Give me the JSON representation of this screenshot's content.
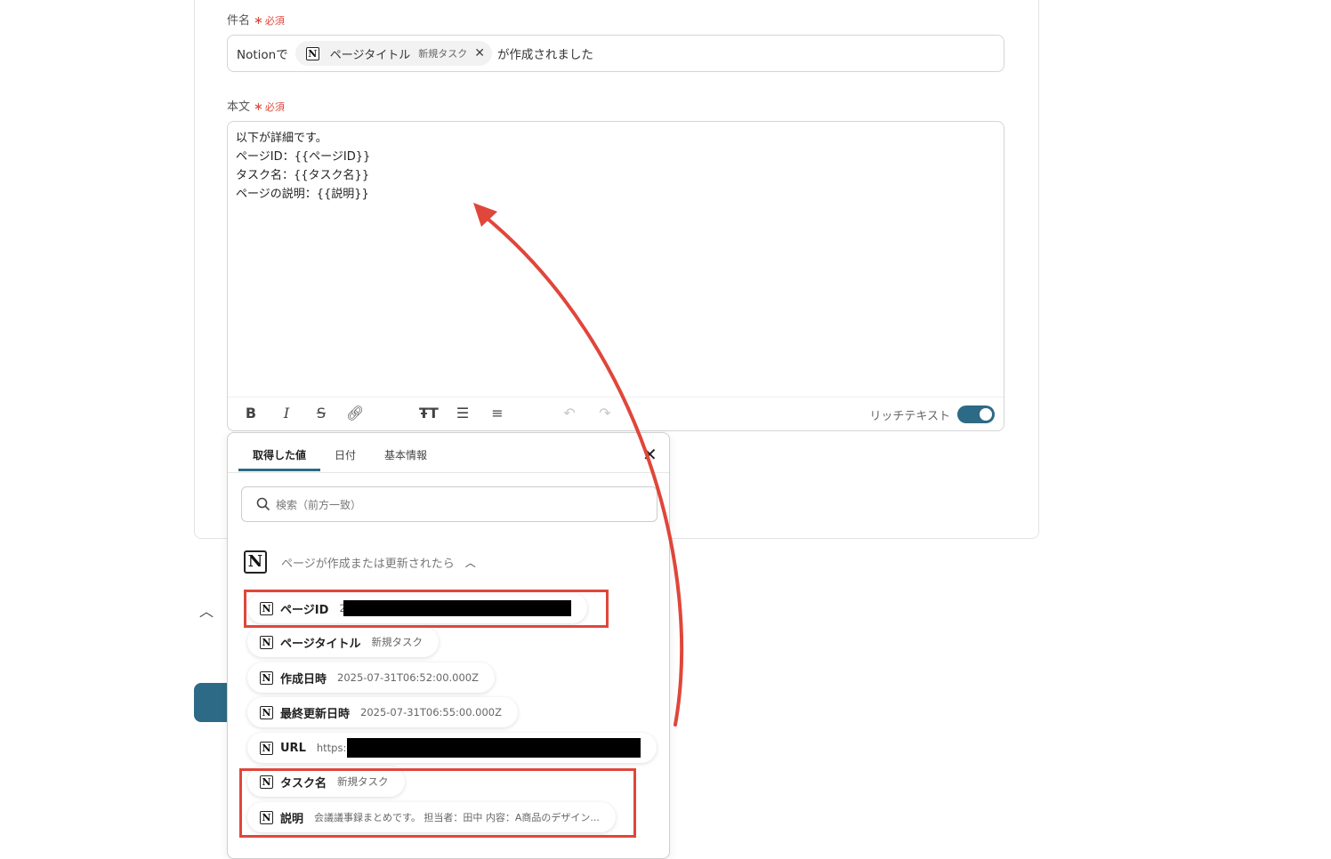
{
  "subject": {
    "label": "件名",
    "required_mark": "∗",
    "required_text": "必須",
    "prefix": "Notionで",
    "chip_label": "ページタイトル",
    "chip_sub": "新規タスク",
    "suffix": "が作成されました"
  },
  "body": {
    "label": "本文",
    "required_mark": "∗",
    "required_text": "必須",
    "lines": [
      "以下が詳細です。",
      "ページID：{{ページID}}",
      "タスク名：{{タスク名}}",
      "ページの説明：{{説明}}"
    ],
    "rich_text_label": "リッチテキスト",
    "rich_text_on": true
  },
  "picker": {
    "tabs": [
      "取得した値",
      "日付",
      "基本情報"
    ],
    "active_tab": 0,
    "search_placeholder": "検索（前方一致）",
    "group_title": "ページが作成または更新されたら",
    "items": [
      {
        "label": "ページID",
        "value": "2"
      },
      {
        "label": "ページタイトル",
        "value": "新規タスク"
      },
      {
        "label": "作成日時",
        "value": "2025-07-31T06:52:00.000Z"
      },
      {
        "label": "最終更新日時",
        "value": "2025-07-31T06:55:00.000Z"
      },
      {
        "label": "URL",
        "value": "https:"
      },
      {
        "label": "タスク名",
        "value": "新規タスク"
      },
      {
        "label": "説明",
        "value": "会議議事録まとめです。 担当者：田中 内容：A商品のデザイン..."
      }
    ]
  },
  "colors": {
    "accent": "#2d6a86",
    "highlight": "#e0463a"
  },
  "icons": {
    "notion": "N"
  }
}
